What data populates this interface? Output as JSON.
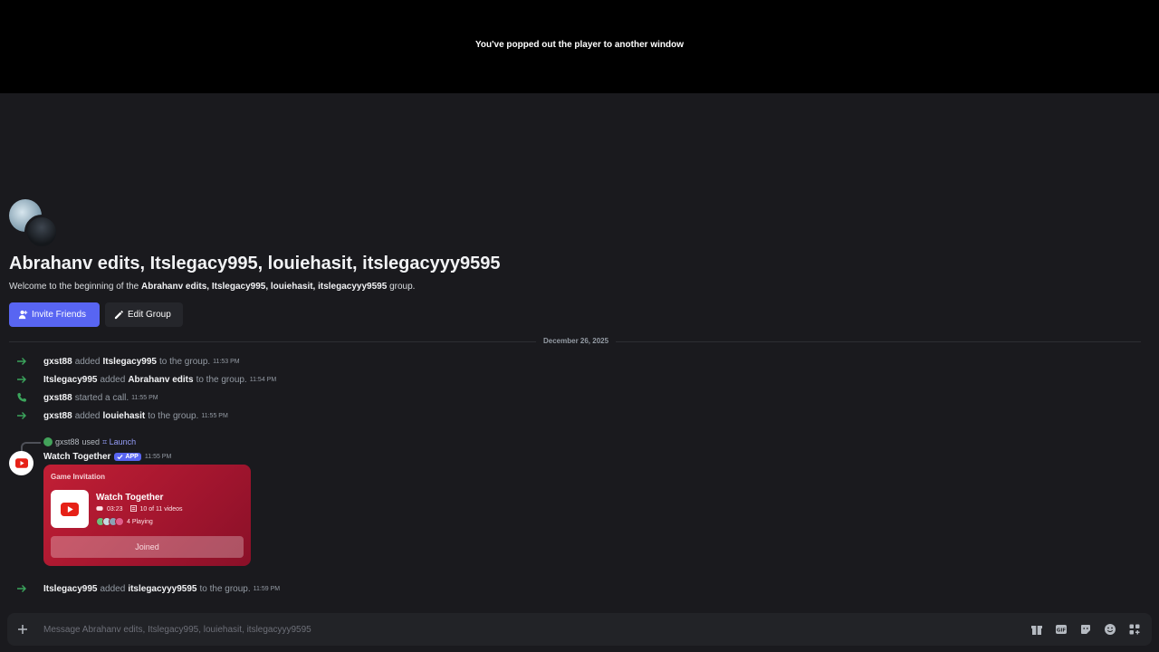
{
  "popout": {
    "message": "You've popped out the player to another window"
  },
  "group": {
    "title": "Abrahanv edits, Itslegacy995, louiehasit, itslegacyyy9595",
    "welcome_prefix": "Welcome to the beginning of the",
    "welcome_names": "Abrahanv edits, Itslegacy995, louiehasit, itslegacyyy9595",
    "welcome_suffix": "group.",
    "invite_label": "Invite Friends",
    "edit_label": "Edit Group"
  },
  "divider_date": "December 26, 2025",
  "system_messages": [
    {
      "icon": "arrow-right-icon",
      "actor": "gxst88",
      "verb": "added",
      "target": "Itslegacy995",
      "tail": "to the group.",
      "time": "11:53 PM"
    },
    {
      "icon": "arrow-right-icon",
      "actor": "Itslegacy995",
      "verb": "added",
      "target": "Abrahanv edits",
      "tail": "to the group.",
      "time": "11:54 PM"
    },
    {
      "icon": "phone-icon",
      "actor": "gxst88",
      "verb": "started a call.",
      "target": "",
      "tail": "",
      "time": "11:55 PM"
    },
    {
      "icon": "arrow-right-icon",
      "actor": "gxst88",
      "verb": "added",
      "target": "louiehasit",
      "tail": "to the group.",
      "time": "11:55 PM"
    },
    {
      "icon": "arrow-right-icon",
      "actor": "Itslegacy995",
      "verb": "added",
      "target": "itslegacyyy9595",
      "tail": "to the group.",
      "time": "11:59 PM"
    }
  ],
  "command": {
    "user": "gxst88",
    "used": "used",
    "name": "Launch"
  },
  "bot": {
    "name": "Watch Together",
    "tag": "APP",
    "time": "11:55 PM"
  },
  "invite_card": {
    "heading": "Game Invitation",
    "activity": "Watch Together",
    "duration": "03:23",
    "videos": "10 of 11 videos",
    "playing": "4 Playing",
    "button": "Joined"
  },
  "composer": {
    "placeholder": "Message Abrahanv edits, Itslegacy995, louiehasit, itslegacyyy9595"
  },
  "colors": {
    "accent": "#5865f2",
    "card": "#b3182f",
    "green": "#3ba55c"
  }
}
